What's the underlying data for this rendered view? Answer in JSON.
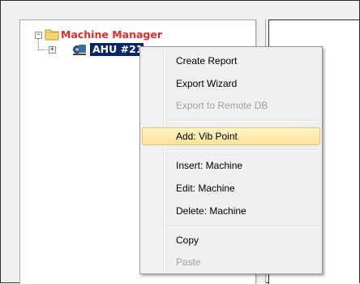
{
  "tree": {
    "root": {
      "label": "Machine Manager",
      "expander": "−",
      "icon": "folder-icon",
      "color": "#e32a2a"
    },
    "child": {
      "label": "AHU #21",
      "expander": "+",
      "icon": "machine-icon",
      "selected_bg": "#0a246a"
    }
  },
  "context_menu": {
    "items": [
      {
        "label": "Create Report",
        "enabled": true
      },
      {
        "label": "Export Wizard",
        "enabled": true
      },
      {
        "label": "Export to Remote DB",
        "enabled": false
      },
      {
        "label": "Add: Vib Point",
        "enabled": true,
        "highlighted": true
      },
      {
        "label": "Insert: Machine",
        "enabled": true
      },
      {
        "label": "Edit: Machine",
        "enabled": true
      },
      {
        "label": "Delete: Machine",
        "enabled": true
      },
      {
        "label": "Copy",
        "enabled": true
      },
      {
        "label": "Paste",
        "enabled": false
      }
    ],
    "highlight_color": "#fde39a"
  }
}
